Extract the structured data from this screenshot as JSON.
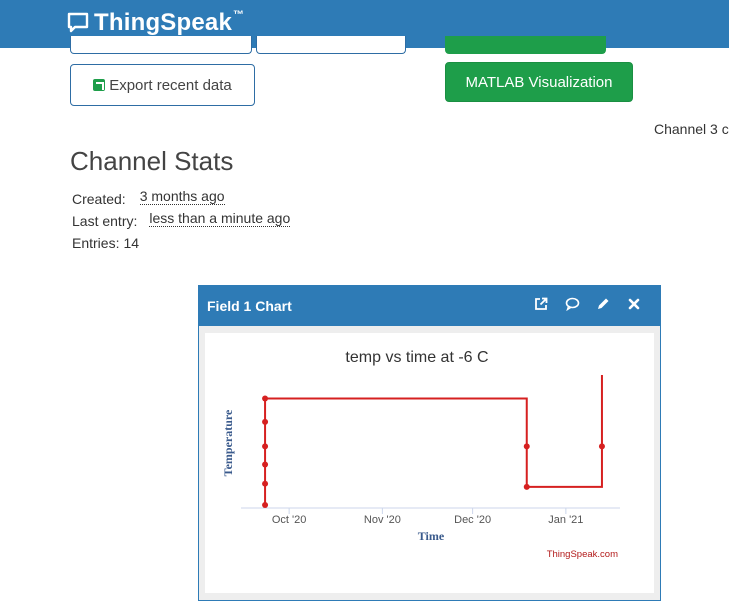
{
  "brand": {
    "name": "ThingSpeak",
    "tm": "™"
  },
  "buttons": {
    "export_recent": "Export recent data",
    "matlab_visualization": "MATLAB Visualization"
  },
  "channel_truncated": "Channel 3 c",
  "stats": {
    "title": "Channel Stats",
    "created_label": "Created:",
    "created_value": "3 months ago",
    "last_entry_label": "Last entry:",
    "last_entry_value": "less than a minute ago",
    "entries_label": "Entries:",
    "entries_value": "14"
  },
  "panel": {
    "title": "Field 1 Chart",
    "icons": [
      "external-link-icon",
      "comment-icon",
      "pencil-icon",
      "close-icon"
    ]
  },
  "chart_data": {
    "type": "line",
    "title": "temp vs time at -6 C",
    "xlabel": "Time",
    "ylabel": "Temperature",
    "x_ticks": [
      "Oct '20",
      "Nov '20",
      "Dec '20",
      "Jan '21"
    ],
    "credit": "ThingSpeak.com",
    "grid": false,
    "line_color": "#d62020",
    "series": [
      {
        "points": [
          {
            "x": "2020-09-23",
            "y": 0.0
          },
          {
            "x": "2020-09-23",
            "y": 0.2
          },
          {
            "x": "2020-09-23",
            "y": 0.38
          },
          {
            "x": "2020-09-23",
            "y": 0.55
          },
          {
            "x": "2020-09-23",
            "y": 0.78
          },
          {
            "x": "2020-09-23",
            "y": 1.0
          },
          {
            "x": "2020-12-19",
            "y": 1.0
          },
          {
            "x": "2020-12-19",
            "y": 0.55
          },
          {
            "x": "2020-12-19",
            "y": 0.17
          },
          {
            "x": "2021-01-13",
            "y": 0.17
          },
          {
            "x": "2021-01-13",
            "y": 0.55
          },
          {
            "x": "2021-01-13",
            "y": 1.22
          }
        ],
        "markers": [
          0,
          1,
          2,
          3,
          4,
          5,
          7,
          8,
          10
        ]
      }
    ]
  }
}
